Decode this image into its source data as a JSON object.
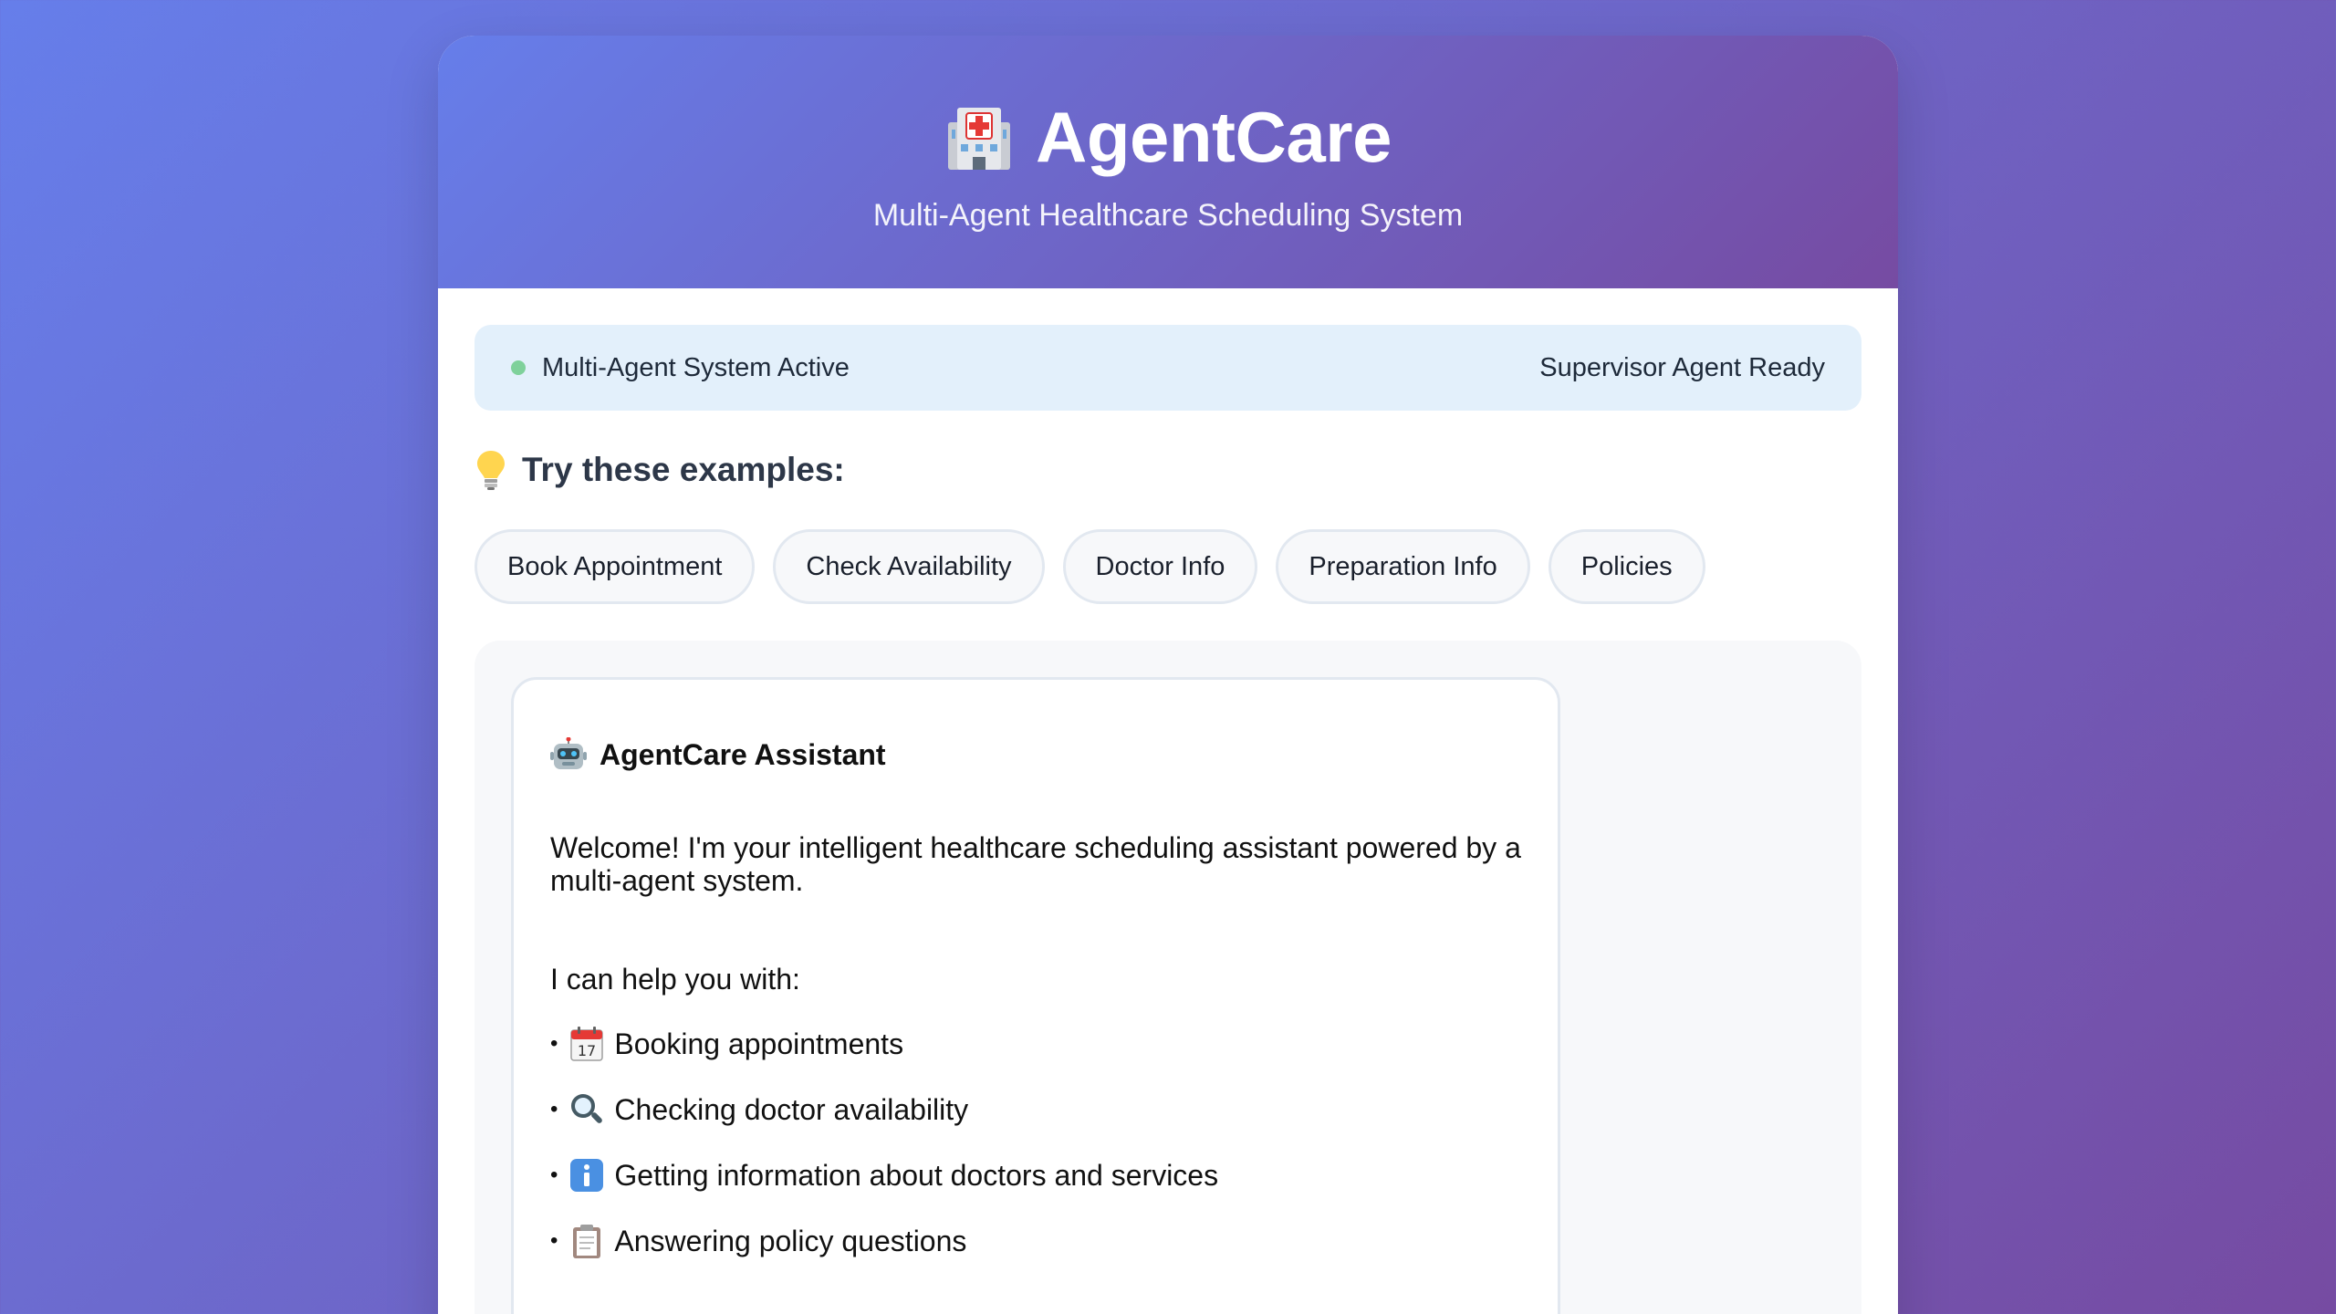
{
  "header": {
    "logo_icon": "hospital-icon",
    "title": "AgentCare",
    "subtitle": "Multi-Agent Healthcare Scheduling System"
  },
  "status": {
    "left_text": "Multi-Agent System Active",
    "right_text": "Supervisor Agent Ready",
    "dot_color": "#7fd19b"
  },
  "examples": {
    "icon": "lightbulb-icon",
    "title": "Try these examples:",
    "chips": [
      {
        "label": "Book Appointment"
      },
      {
        "label": "Check Availability"
      },
      {
        "label": "Doctor Info"
      },
      {
        "label": "Preparation Info"
      },
      {
        "label": "Policies"
      }
    ]
  },
  "message": {
    "icon": "robot-icon",
    "sender": "AgentCare Assistant",
    "welcome": "Welcome! I'm your intelligent healthcare scheduling assistant powered by a multi-agent system.",
    "intro": "I can help you with:",
    "features": [
      {
        "icon": "calendar-icon",
        "text": "Booking appointments"
      },
      {
        "icon": "magnifier-icon",
        "text": "Checking doctor availability"
      },
      {
        "icon": "info-icon",
        "text": "Getting information about doctors and services"
      },
      {
        "icon": "clipboard-icon",
        "text": "Answering policy questions"
      }
    ]
  },
  "colors": {
    "gradient_start": "#667eea",
    "gradient_end": "#764ba2",
    "status_bg": "#e3f0fb"
  }
}
